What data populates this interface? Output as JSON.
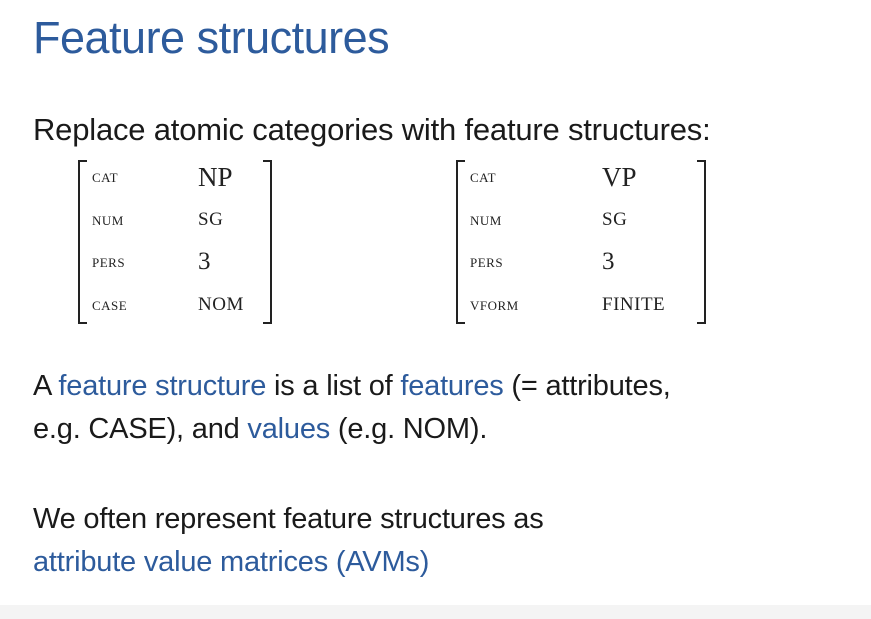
{
  "title": "Feature structures",
  "intro": "Replace atomic categories with feature structures:",
  "avm_left": {
    "rows": [
      {
        "attr": "CAT",
        "value": "NP"
      },
      {
        "attr": "NUM",
        "value": "SG"
      },
      {
        "attr": "PERS",
        "value": "3"
      },
      {
        "attr": "CASE",
        "value": "NOM"
      }
    ]
  },
  "avm_right": {
    "rows": [
      {
        "attr": "CAT",
        "value": "VP"
      },
      {
        "attr": "NUM",
        "value": "SG"
      },
      {
        "attr": "PERS",
        "value": "3"
      },
      {
        "attr": "VFORM",
        "value": "FINITE"
      }
    ]
  },
  "para1": {
    "t1": "A ",
    "hl1": "feature structure",
    "t2": " is a list of ",
    "hl2": "features",
    "t3": " (= attributes,",
    "t4": "e.g. CASE), and ",
    "hl3": "values",
    "t5": " (e.g. NOM)."
  },
  "para2": {
    "line1": "We often represent feature structures as",
    "hl": "attribute value matrices (AVMs)"
  },
  "colors": {
    "accent": "#2d5b9c",
    "text": "#1a1a1a"
  }
}
